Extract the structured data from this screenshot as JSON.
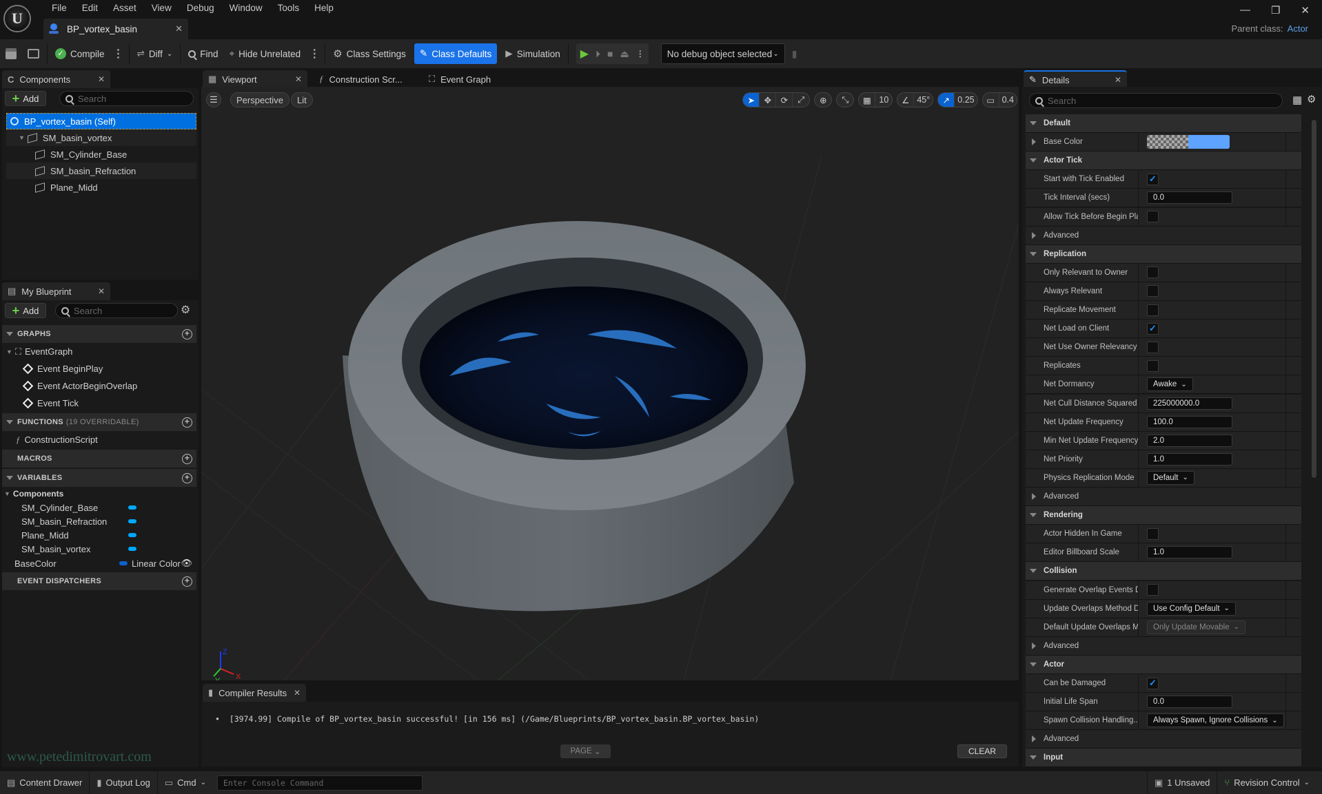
{
  "window": {
    "menu": [
      "File",
      "Edit",
      "Asset",
      "View",
      "Debug",
      "Window",
      "Tools",
      "Help"
    ],
    "doc_tab": "BP_vortex_basin",
    "parent_class_label": "Parent class:",
    "parent_class_value": "Actor"
  },
  "toolbar": {
    "compile": "Compile",
    "diff": "Diff",
    "find": "Find",
    "hide_unrelated": "Hide Unrelated",
    "class_settings": "Class Settings",
    "class_defaults": "Class Defaults",
    "simulation": "Simulation",
    "debug_object": "No debug object selected"
  },
  "components": {
    "tab": "Components",
    "add": "Add",
    "search_placeholder": "Search",
    "tree": [
      {
        "label": "BP_vortex_basin (Self)",
        "level": 0,
        "selected": true
      },
      {
        "label": "SM_basin_vortex",
        "level": 1
      },
      {
        "label": "SM_Cylinder_Base",
        "level": 2
      },
      {
        "label": "SM_basin_Refraction",
        "level": 2
      },
      {
        "label": "Plane_Midd",
        "level": 2
      }
    ]
  },
  "my_blueprint": {
    "tab": "My Blueprint",
    "add": "Add",
    "search_placeholder": "Search",
    "graphs_header": "GRAPHS",
    "event_graph": "EventGraph",
    "events": [
      "Event BeginPlay",
      "Event ActorBeginOverlap",
      "Event Tick"
    ],
    "functions_header": "FUNCTIONS",
    "functions_note": "(19 OVERRIDABLE)",
    "functions": [
      "ConstructionScript"
    ],
    "macros_header": "MACROS",
    "variables_header": "VARIABLES",
    "components_group": "Components",
    "component_vars": [
      "SM_Cylinder_Base",
      "SM_basin_Refraction",
      "Plane_Midd",
      "SM_basin_vortex"
    ],
    "base_color_var": "BaseColor",
    "base_color_type": "Linear Color",
    "dispatchers_header": "EVENT DISPATCHERS"
  },
  "editor_tabs": [
    "Viewport",
    "Construction Scr...",
    "Event Graph"
  ],
  "viewport": {
    "perspective": "Perspective",
    "lit": "Lit",
    "grid_snap": "10",
    "rotation_snap": "45°",
    "scale_snap": "0.25",
    "camera_speed": "0.4",
    "axis_labels": {
      "x": "X",
      "y": "Y",
      "z": "Z"
    }
  },
  "details": {
    "tab": "Details",
    "search_placeholder": "Search",
    "rows": [
      {
        "type": "cat",
        "label": "Default"
      },
      {
        "type": "color",
        "label": "Base Color",
        "collapsed": true,
        "color": "#5ea3ff"
      },
      {
        "type": "cat",
        "label": "Actor Tick"
      },
      {
        "type": "check",
        "label": "Start with Tick Enabled",
        "checked": true
      },
      {
        "type": "num",
        "label": "Tick Interval (secs)",
        "value": "0.0"
      },
      {
        "type": "check",
        "label": "Allow Tick Before Begin Play",
        "checked": false
      },
      {
        "type": "adv",
        "label": "Advanced"
      },
      {
        "type": "cat",
        "label": "Replication"
      },
      {
        "type": "check",
        "label": "Only Relevant to Owner",
        "checked": false
      },
      {
        "type": "check",
        "label": "Always Relevant",
        "checked": false
      },
      {
        "type": "check",
        "label": "Replicate Movement",
        "checked": false
      },
      {
        "type": "check",
        "label": "Net Load on Client",
        "checked": true
      },
      {
        "type": "check",
        "label": "Net Use Owner Relevancy",
        "checked": false
      },
      {
        "type": "check",
        "label": "Replicates",
        "checked": false
      },
      {
        "type": "dd",
        "label": "Net Dormancy",
        "value": "Awake"
      },
      {
        "type": "num",
        "label": "Net Cull Distance Squared",
        "value": "225000000.0"
      },
      {
        "type": "num",
        "label": "Net Update Frequency",
        "value": "100.0"
      },
      {
        "type": "num",
        "label": "Min Net Update Frequency",
        "value": "2.0"
      },
      {
        "type": "num",
        "label": "Net Priority",
        "value": "1.0"
      },
      {
        "type": "dd",
        "label": "Physics Replication Mode",
        "value": "Default"
      },
      {
        "type": "adv",
        "label": "Advanced"
      },
      {
        "type": "cat",
        "label": "Rendering"
      },
      {
        "type": "check",
        "label": "Actor Hidden In Game",
        "checked": false
      },
      {
        "type": "num",
        "label": "Editor Billboard Scale",
        "value": "1.0"
      },
      {
        "type": "cat",
        "label": "Collision"
      },
      {
        "type": "check",
        "label": "Generate Overlap Events D...",
        "checked": false
      },
      {
        "type": "dd",
        "label": "Update Overlaps Method D...",
        "value": "Use Config Default"
      },
      {
        "type": "dd",
        "label": "Default Update Overlaps M...",
        "value": "Only Update Movable",
        "disabled": true
      },
      {
        "type": "adv",
        "label": "Advanced"
      },
      {
        "type": "cat",
        "label": "Actor"
      },
      {
        "type": "check",
        "label": "Can be Damaged",
        "checked": true
      },
      {
        "type": "num",
        "label": "Initial Life Span",
        "value": "0.0"
      },
      {
        "type": "dd",
        "label": "Spawn Collision Handling...",
        "value": "Always Spawn, Ignore Collisions"
      },
      {
        "type": "adv",
        "label": "Advanced"
      },
      {
        "type": "cat",
        "label": "Input"
      }
    ]
  },
  "compiler": {
    "tab": "Compiler Results",
    "message": "[3974.99] Compile of BP_vortex_basin successful! [in 156 ms] (/Game/Blueprints/BP_vortex_basin.BP_vortex_basin)",
    "page": "PAGE",
    "clear": "CLEAR"
  },
  "statusbar": {
    "content_drawer": "Content Drawer",
    "output_log": "Output Log",
    "cmd": "Cmd",
    "console_placeholder": "Enter Console Command",
    "unsaved": "1 Unsaved",
    "revision_control": "Revision Control"
  },
  "watermark": "www.petedimitrovart.com"
}
